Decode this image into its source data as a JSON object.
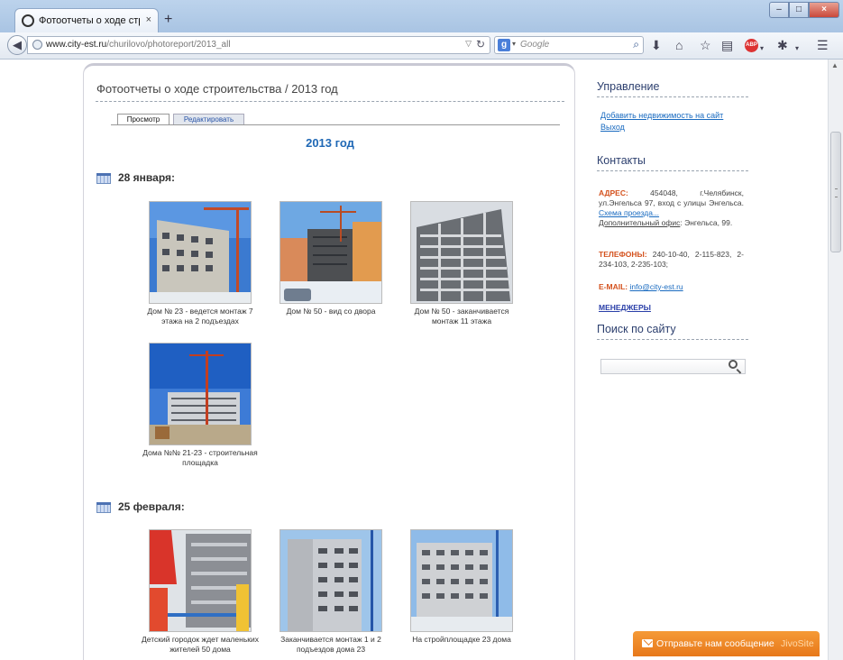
{
  "browser": {
    "tab_title": "Фотоотчеты о ходе строи...",
    "tab_close": "×",
    "new_tab": "+",
    "window_min": "–",
    "window_max": "□",
    "window_close": "×",
    "url_domain": "www.city-est.ru",
    "url_path": "/churilovo/photoreport/2013_all",
    "search_placeholder": "Google",
    "search_engine_letter": "g",
    "icons": [
      "back-icon",
      "globe-icon",
      "reload-icon",
      "google-icon",
      "search-icon",
      "download-icon",
      "home-icon",
      "bookmark-star-icon",
      "reading-list-icon",
      "adblock-icon",
      "extension-icon",
      "menu-icon"
    ],
    "abp_label": "ABP"
  },
  "main": {
    "title": "Фотоотчеты о ходе строительства / 2013 год",
    "tabs": [
      {
        "label": "Просмотр",
        "active": true
      },
      {
        "label": "Редактировать",
        "active": false
      }
    ],
    "year_heading": "2013 год",
    "sections": [
      {
        "date": "28 января:",
        "photos": [
          {
            "caption": "Дом № 23 - ведется монтаж 7 этажа на 2 подъездах"
          },
          {
            "caption": "Дом № 50 - вид со двора"
          },
          {
            "caption": "Дом № 50 - заканчивается монтаж 11 этажа"
          },
          {
            "caption": "Дома №№ 21-23 - строительная площадка"
          }
        ]
      },
      {
        "date": "25 февраля:",
        "photos": [
          {
            "caption": "Детский городок ждет маленьких жителей 50 дома"
          },
          {
            "caption": "Заканчивается монтаж 1 и 2 подъездов дома 23"
          },
          {
            "caption": "На стройплощадке 23 дома"
          }
        ]
      }
    ]
  },
  "sidebar": {
    "management_heading": "Управление",
    "management_links": [
      "Добавить недвижимость на сайт",
      "Выход"
    ],
    "contacts_heading": "Контакты",
    "address_label": "АДРЕС:",
    "address_text": " 454048, г.Челябинск, ул.Энгельса 97, вход с улицы Энгельса. ",
    "address_link": "Схема проезда...",
    "office_label": "Дополнительный офис",
    "office_text": ": Энгельса, 99.",
    "phones_label": "ТЕЛЕФОНЫ:",
    "phones_text": " 240-10-40, 2-115-823, 2-234-103, 2-235-103;",
    "email_label": "E-MAIL:",
    "email_value": "info@city-est.ru",
    "managers_link": "МЕНЕДЖЕРЫ",
    "search_heading": "Поиск по сайту"
  },
  "jivo": {
    "text": "Отправьте нам сообщение",
    "brand": "JivoSite"
  },
  "colors": {
    "accent_blue": "#1f68b5",
    "label_orange": "#d4521e",
    "jivo_orange": "#e7781b"
  }
}
